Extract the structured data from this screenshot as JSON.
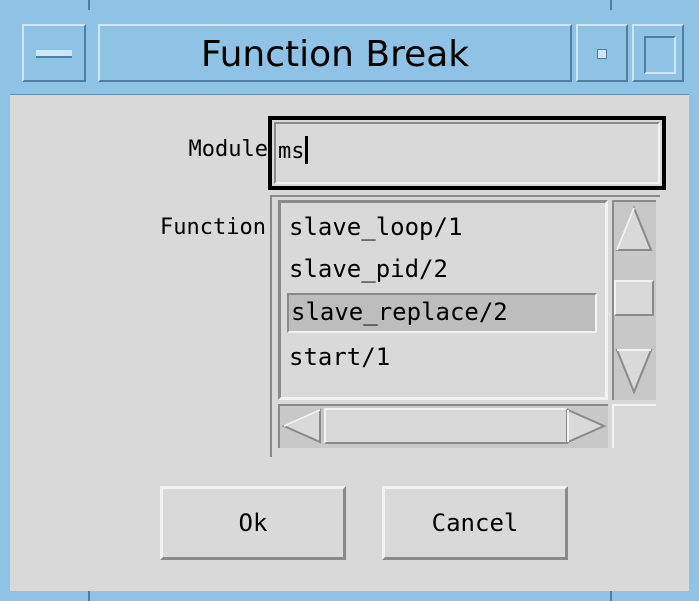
{
  "window": {
    "title": "Function Break"
  },
  "form": {
    "module_label": "Module",
    "module_value": "ms",
    "function_label": "Function",
    "functions": [
      "slave_loop/1",
      "slave_pid/2",
      "slave_replace/2",
      "start/1"
    ],
    "selected_function": "slave_replace/2"
  },
  "buttons": {
    "ok": "Ok",
    "cancel": "Cancel"
  },
  "icons": {
    "window_menu": "minus-bar-icon",
    "minimize": "minimize-icon",
    "maximize": "maximize-icon",
    "scroll_up": "triangle-up-icon",
    "scroll_down": "triangle-down-icon",
    "scroll_left": "triangle-left-icon",
    "scroll_right": "triangle-right-icon"
  },
  "colors": {
    "titlebar": "#8fc3e6",
    "background": "#d9d9d9",
    "selection": "#bdbdbd"
  }
}
